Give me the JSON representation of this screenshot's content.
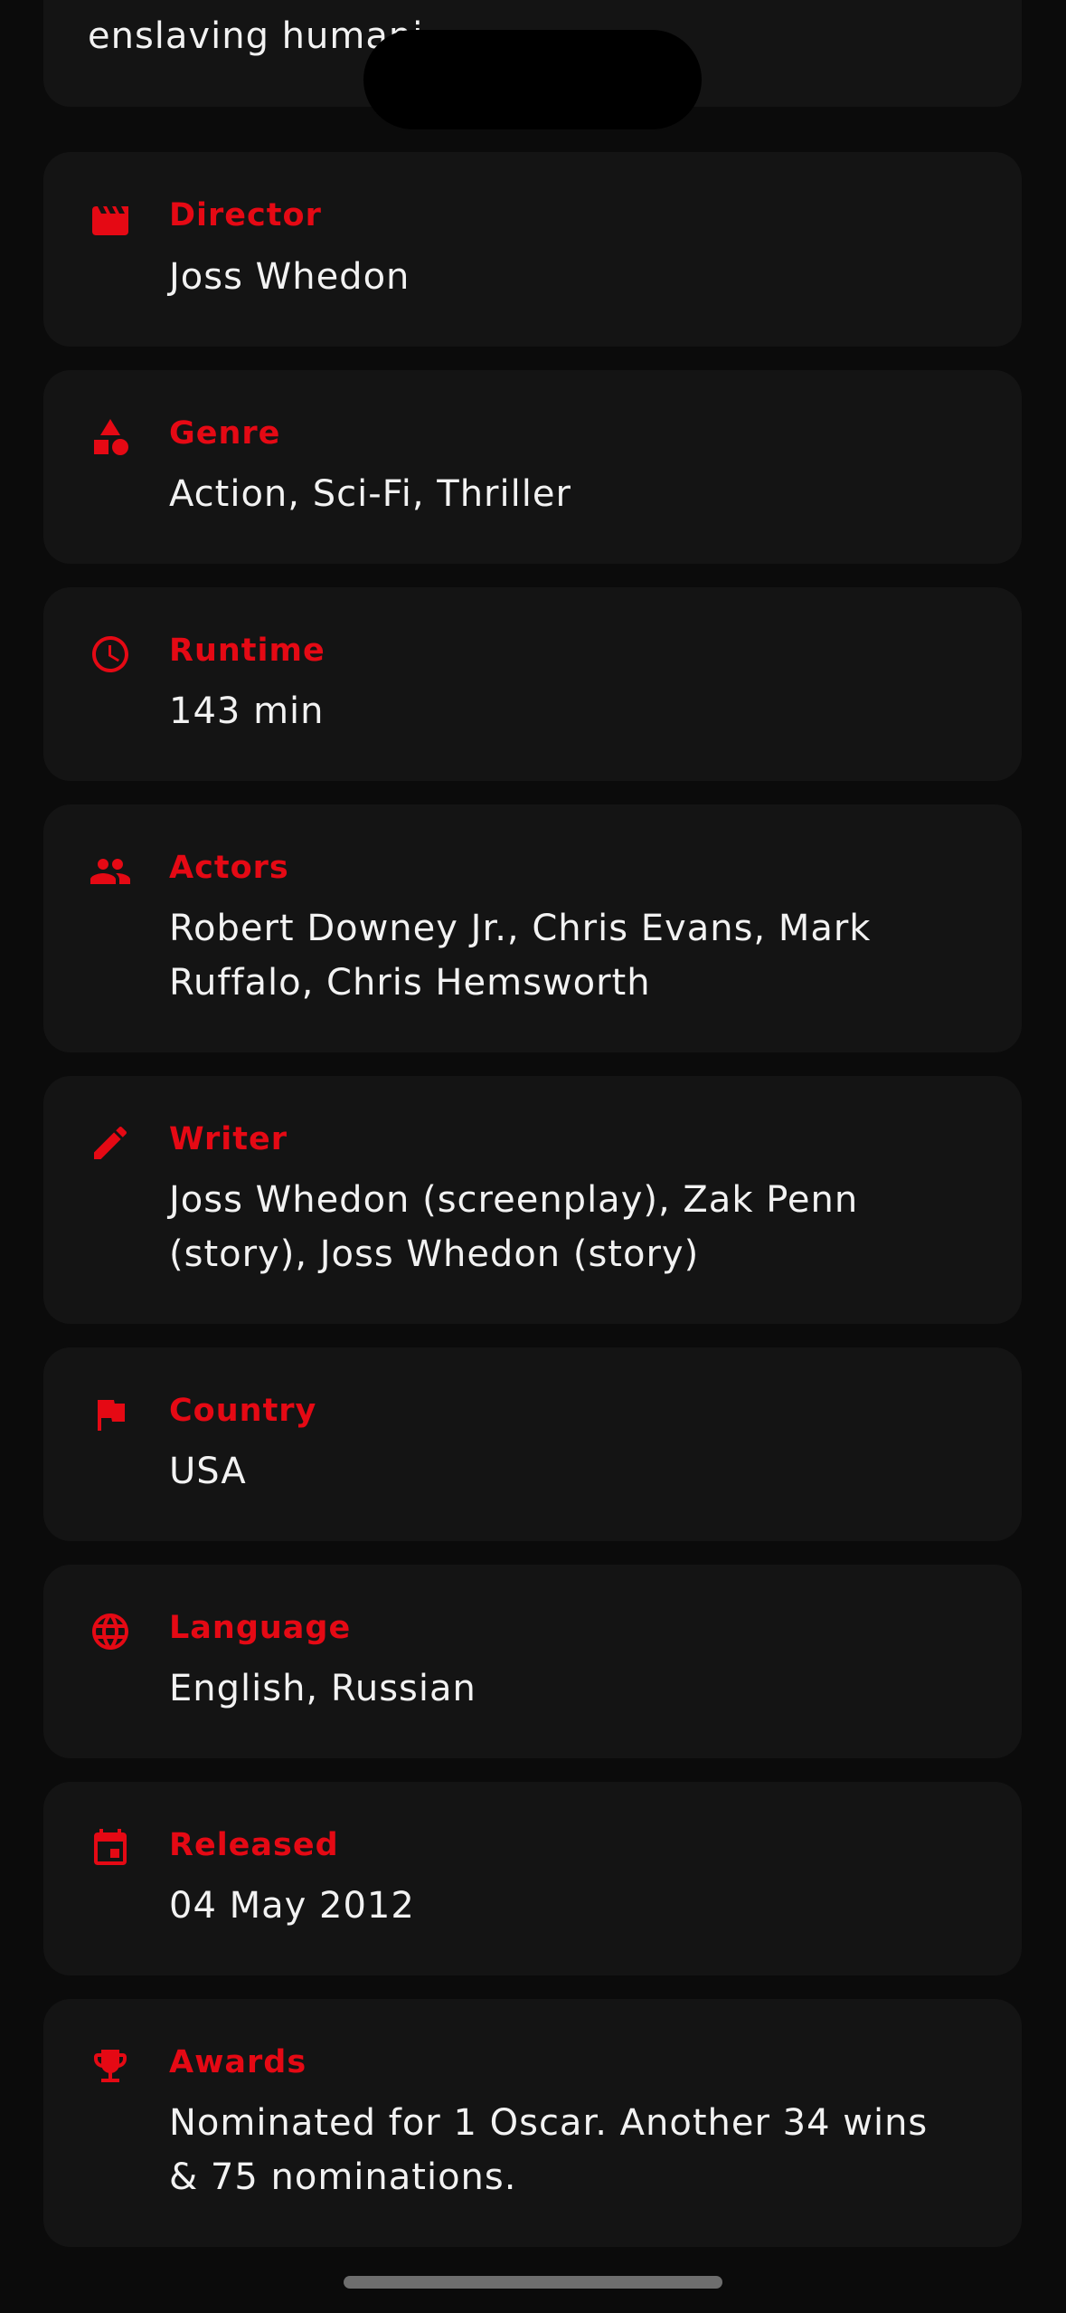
{
  "plot": {
    "partial_text": "enslaving humani"
  },
  "details": [
    {
      "label": "Director",
      "value": "Joss Whedon",
      "icon": "clapperboard-icon"
    },
    {
      "label": "Genre",
      "value": "Action, Sci-Fi, Thriller",
      "icon": "shapes-icon"
    },
    {
      "label": "Runtime",
      "value": "143 min",
      "icon": "clock-icon"
    },
    {
      "label": "Actors",
      "value": "Robert Downey Jr., Chris Evans, Mark Ruffalo, Chris Hemsworth",
      "icon": "people-icon"
    },
    {
      "label": "Writer",
      "value": "Joss Whedon (screenplay), Zak Penn (story), Joss Whedon (story)",
      "icon": "pencil-icon"
    },
    {
      "label": "Country",
      "value": "USA",
      "icon": "flag-icon"
    },
    {
      "label": "Language",
      "value": "English, Russian",
      "icon": "globe-icon"
    },
    {
      "label": "Released",
      "value": "04 May 2012",
      "icon": "calendar-icon"
    },
    {
      "label": "Awards",
      "value": "Nominated for 1 Oscar. Another 34 wins & 75 nominations.",
      "icon": "trophy-icon"
    }
  ],
  "colors": {
    "accent": "#e50914",
    "background": "#0b0b0b",
    "card": "#141414",
    "text": "#f2f2f2"
  }
}
